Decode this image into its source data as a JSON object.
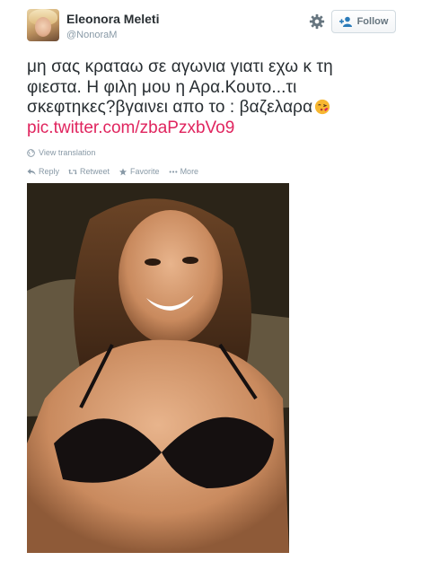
{
  "header": {
    "fullname": "Eleonora Meleti",
    "screenname": "@NonoraM",
    "follow_label": "Follow",
    "gear_icon": "gear-icon",
    "follow_icon": "follow-person-icon"
  },
  "tweet": {
    "text_lines": [
      "μη σας κραταω σε αγωνια γιατι  εχω κ τη",
      "φιεστα. Η φιλη μου η Αρα.Κουτο...τι",
      "σκεφτηκες?βγαινει απο το : βαζελαρα"
    ],
    "emoji": "kissing-face-emoji",
    "link": "pic.twitter.com/zbaPzxbVo9",
    "link_color": "#e0245e",
    "translate_label": "View translation"
  },
  "actions": {
    "reply": "Reply",
    "retweet": "Retweet",
    "favorite": "Favorite",
    "more": "More"
  },
  "media": {
    "description_icon": "photo-image"
  }
}
